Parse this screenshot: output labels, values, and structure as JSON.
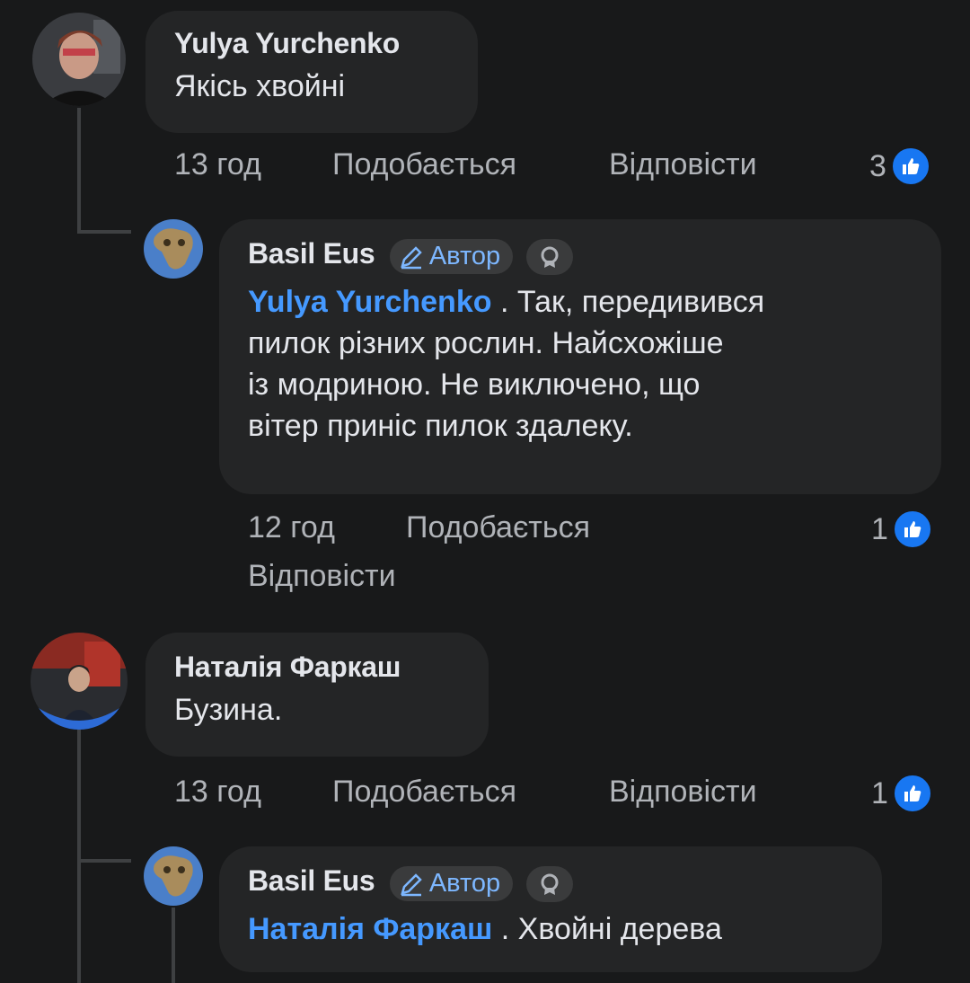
{
  "comments": [
    {
      "author": "Yulya Yurchenko",
      "text": "Якісь хвойні",
      "time": "13 год",
      "like_label": "Подобається",
      "reply_label": "Відповісти",
      "reactions": "3"
    },
    {
      "author": "Basil Eus",
      "badge": "Автор",
      "mention": "Yulya Yurchenko",
      "text_lines": [
        ". Так, передивився",
        "пилок різних рослин. Найсхожіше",
        "із модриною. Не виключено, що",
        "вітер приніс пилок здалеку."
      ],
      "time": "12 год",
      "like_label": "Подобається",
      "reply_label": "Відповісти",
      "reactions": "1"
    },
    {
      "author": "Наталія Фаркаш",
      "text": "Бузина.",
      "time": "13 год",
      "like_label": "Подобається",
      "reply_label": "Відповісти",
      "reactions": "1"
    },
    {
      "author": "Basil Eus",
      "badge": "Автор",
      "mention": "Наталія Фаркаш",
      "text": ". Хвойні дерева"
    }
  ],
  "colors": {
    "background": "#18191a",
    "bubble": "#242526",
    "mention": "#4599ff",
    "like": "#1877f2",
    "muted": "#b0b3b8"
  },
  "icons": [
    "like-icon",
    "pencil-icon",
    "award-icon"
  ]
}
